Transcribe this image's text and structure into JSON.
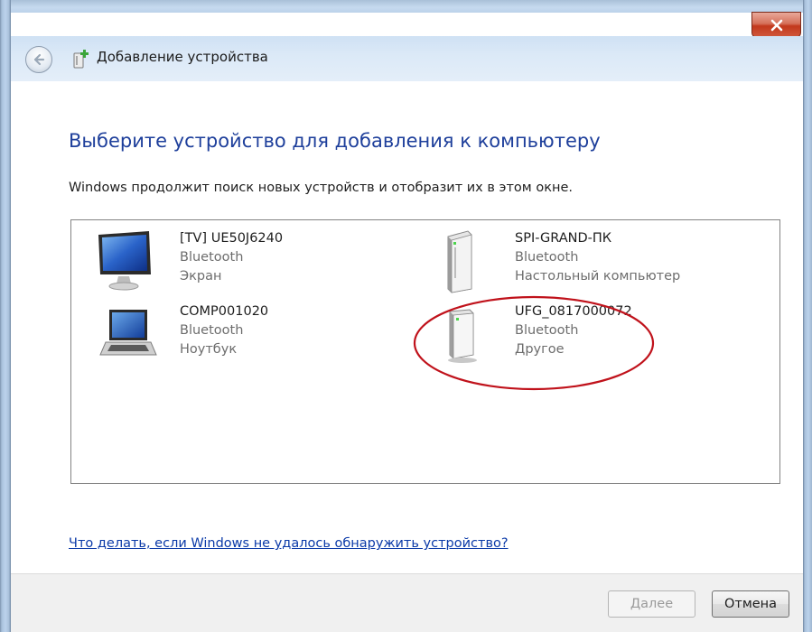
{
  "window": {
    "title": "Добавление устройства"
  },
  "main": {
    "heading": "Выберите устройство для добавления к компьютеру",
    "subtext": "Windows продолжит поиск новых устройств и отобразит их в этом окне."
  },
  "devices": [
    {
      "name": "[TV] UE50J6240",
      "connection": "Bluetooth",
      "type": "Экран",
      "icon": "monitor-icon"
    },
    {
      "name": "SPI-GRAND-ПК",
      "connection": "Bluetooth",
      "type": "Настольный компьютер",
      "icon": "desktop-tower-icon"
    },
    {
      "name": "COMP001020",
      "connection": "Bluetooth",
      "type": "Ноутбук",
      "icon": "laptop-icon"
    },
    {
      "name": "UFG_0817000072",
      "connection": "Bluetooth",
      "type": "Другое",
      "icon": "generic-device-icon"
    }
  ],
  "help": {
    "link": "Что делать, если Windows не удалось обнаружить устройство?"
  },
  "footer": {
    "next_label": "Далее",
    "next_enabled": false,
    "cancel_label": "Отмена"
  },
  "colors": {
    "heading": "#1e3f9b",
    "link": "#0b3aa8",
    "annotation": "#c0121b",
    "close_button": "#c2381c"
  }
}
